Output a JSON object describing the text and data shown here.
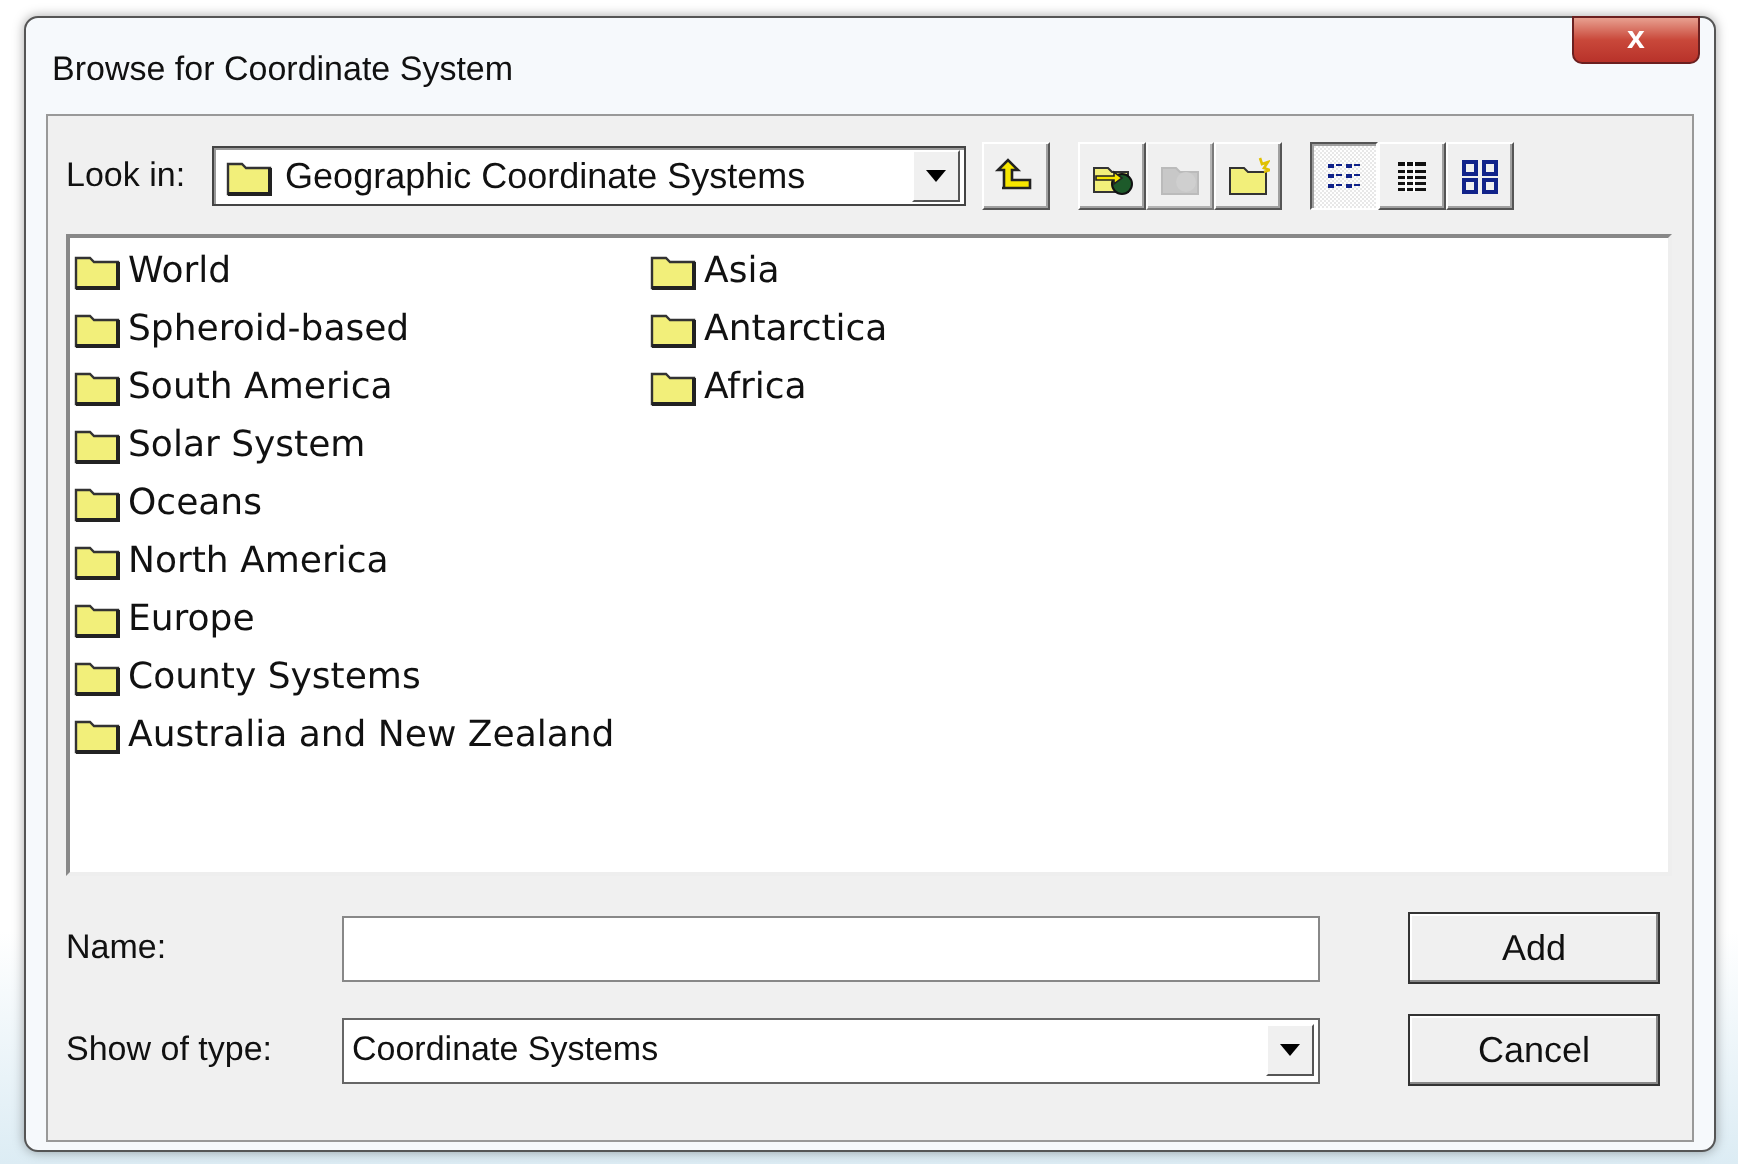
{
  "window": {
    "title": "Browse for Coordinate System",
    "close_button": "x"
  },
  "look_in": {
    "label": "Look in:",
    "value": "Geographic Coordinate Systems"
  },
  "toolbar": [
    {
      "kind": "up",
      "disabled": false,
      "selected": false
    },
    {
      "kind": "connect",
      "disabled": false,
      "selected": false
    },
    {
      "kind": "disconnect",
      "disabled": true,
      "selected": false
    },
    {
      "kind": "new-folder",
      "disabled": false,
      "selected": false
    },
    {
      "kind": "list-view",
      "disabled": false,
      "selected": true
    },
    {
      "kind": "details-view",
      "disabled": false,
      "selected": false
    },
    {
      "kind": "icons-view",
      "disabled": false,
      "selected": false
    }
  ],
  "folders": [
    "World",
    "Spheroid-based",
    "South America",
    "Solar System",
    "Oceans",
    "North America",
    "Europe",
    "County Systems",
    "Australia and New Zealand",
    "Asia",
    "Antarctica",
    "Africa"
  ],
  "name_field": {
    "label": "Name:"
  },
  "type_field": {
    "label": "Show of type:",
    "value": "Coordinate Systems"
  },
  "buttons": [
    "Add",
    "Cancel"
  ]
}
